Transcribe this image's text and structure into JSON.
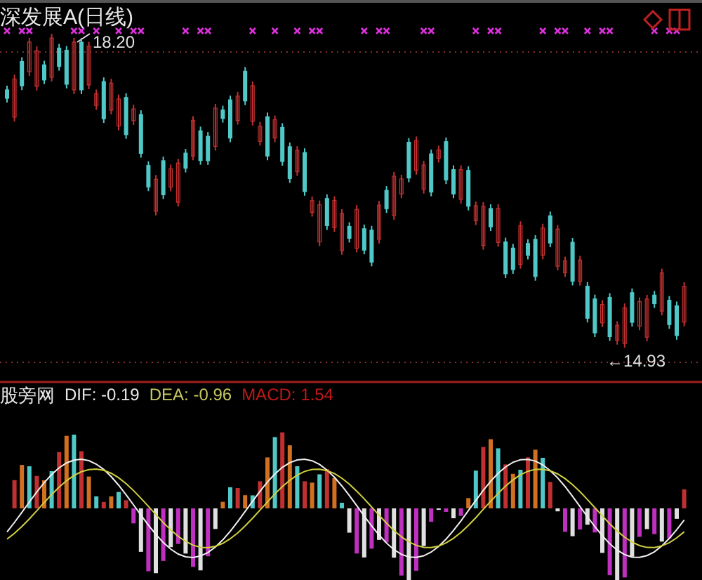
{
  "title": "深发展A(日线)",
  "price_chart": {
    "high_label": "18.20",
    "low_label": "←14.93"
  },
  "indicator": {
    "name": "股旁网",
    "values": [
      {
        "text": "DIF: -0.19",
        "color": "#e8e8e8"
      },
      {
        "text": "DEA: -0.96",
        "color": "#c8c860"
      },
      {
        "text": "MACD: 1.54",
        "color": "#c01818"
      }
    ]
  }
}
